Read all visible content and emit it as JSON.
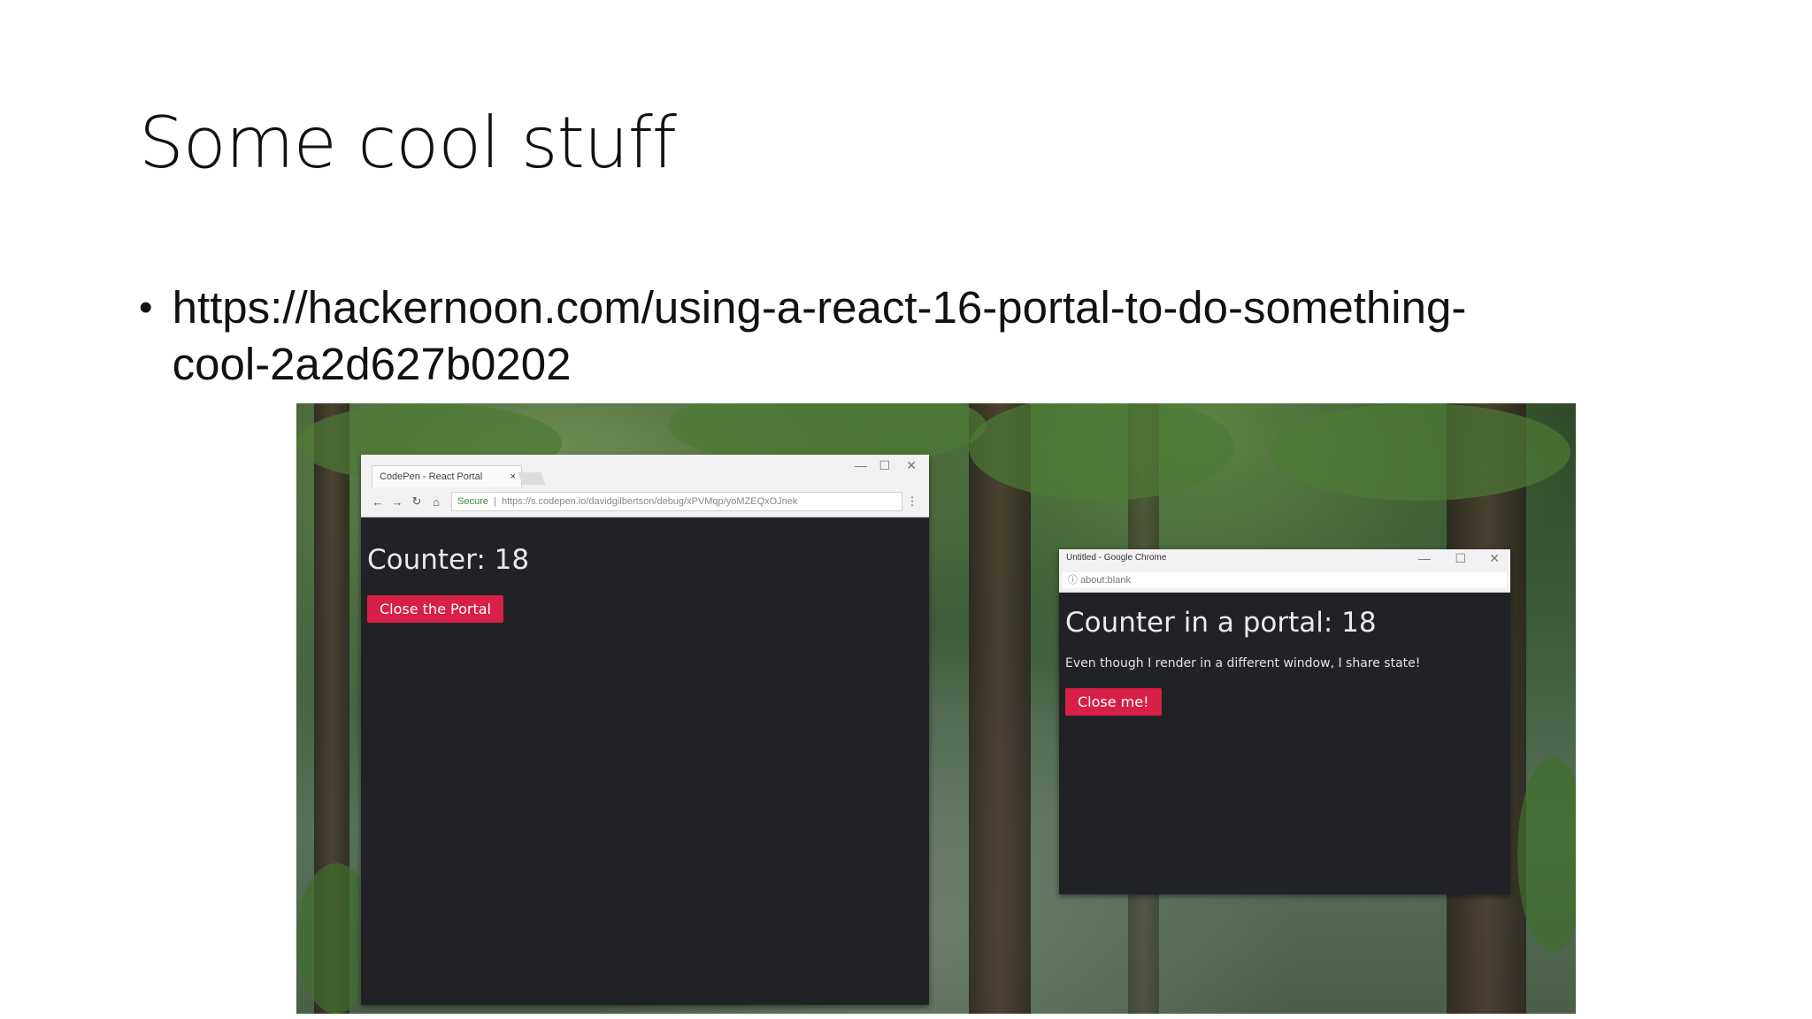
{
  "slide": {
    "title": "Some cool stuff",
    "bullet": "•",
    "link_line1": "https://hackernoon.com/using-a-react-16-portal-to-do-something-",
    "link_line2": "cool-2a2d627b0202"
  },
  "screenshot": {
    "window1": {
      "tab_title": "CodePen - React Portal",
      "tab_close": "×",
      "secure_label": "Secure",
      "url": "https://s.codepen.io/davidgilbertson/debug/xPVMqp/yoMZEQxOJnek",
      "counter_text": "Counter: 18",
      "button_label": "Close the Portal",
      "controls": {
        "minimize": "—",
        "maximize": "☐",
        "close": "✕"
      }
    },
    "window2": {
      "title": "Untitled - Google Chrome",
      "url": "about:blank",
      "heading": "Counter in a portal: 18",
      "message": "Even though I render in a different window, I share state!",
      "button_label": "Close me!",
      "controls": {
        "minimize": "—",
        "maximize": "☐",
        "close": "✕"
      }
    }
  }
}
